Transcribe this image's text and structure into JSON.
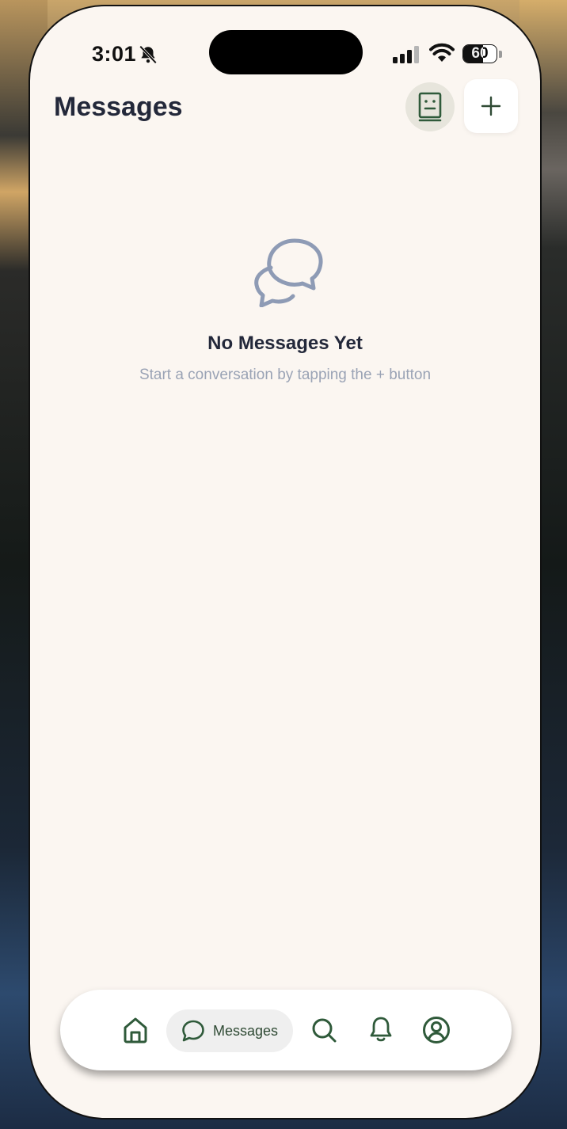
{
  "status_bar": {
    "time": "3:01",
    "battery": "60",
    "battery_level": 0.6
  },
  "header": {
    "title": "Messages"
  },
  "empty_state": {
    "title": "No Messages Yet",
    "subtitle": "Start a conversation by tapping the + button"
  },
  "tab_bar": {
    "items": [
      {
        "icon": "home-icon",
        "label": ""
      },
      {
        "icon": "chat-bubble-icon",
        "label": "Messages",
        "active": true
      },
      {
        "icon": "search-icon",
        "label": ""
      },
      {
        "icon": "bell-icon",
        "label": ""
      },
      {
        "icon": "profile-icon",
        "label": ""
      }
    ]
  },
  "colors": {
    "background": "#fbf6f1",
    "accent": "#2f5a3a",
    "title_text": "#23283a",
    "muted_text": "#9aa3b5",
    "empty_icon": "#8e9bb5"
  }
}
